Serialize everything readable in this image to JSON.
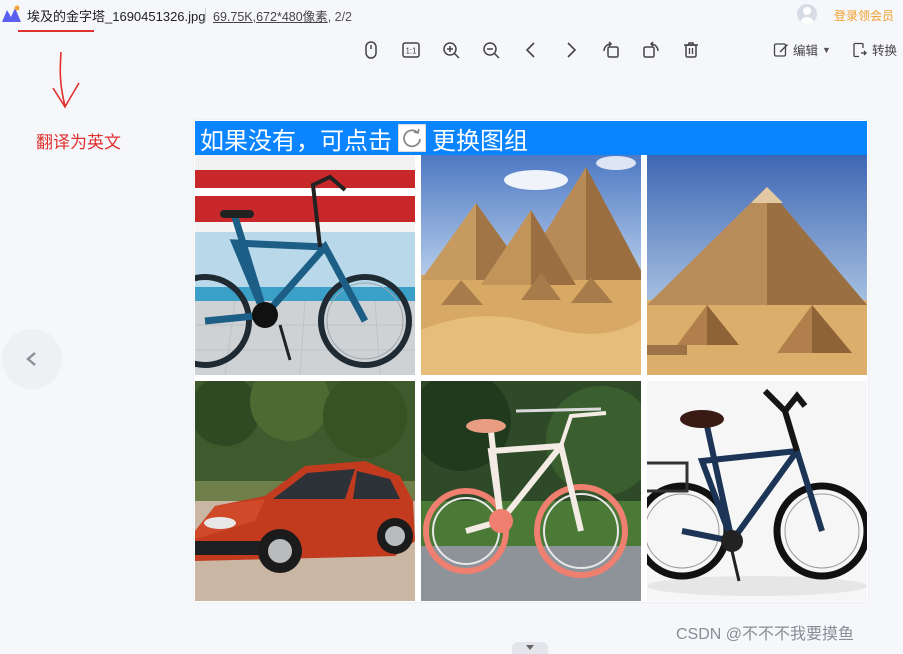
{
  "window": {
    "filename": "埃及的金字塔_1690451326.jpg",
    "file_size": "69.75K",
    "separator": ",",
    "dimensions": "672*480像素",
    "page_counter": ", 2/2",
    "vip_label": "登录领会员"
  },
  "toolbar": {
    "edit_label": "编辑",
    "convert_label": "转换"
  },
  "annotation": {
    "text": "翻译为英文"
  },
  "captcha": {
    "instruction_before": "如果没有，可点击",
    "instruction_after": "更换图组",
    "tiles": [
      "bicycle",
      "pyramids",
      "pyramid",
      "car",
      "bicycle",
      "bicycle"
    ]
  },
  "watermark": "CSDN @不不不我要摸鱼",
  "colors": {
    "header_blue": "#0b84ff",
    "annotation_red": "#e0312f",
    "vip_orange": "#f0a02a"
  }
}
